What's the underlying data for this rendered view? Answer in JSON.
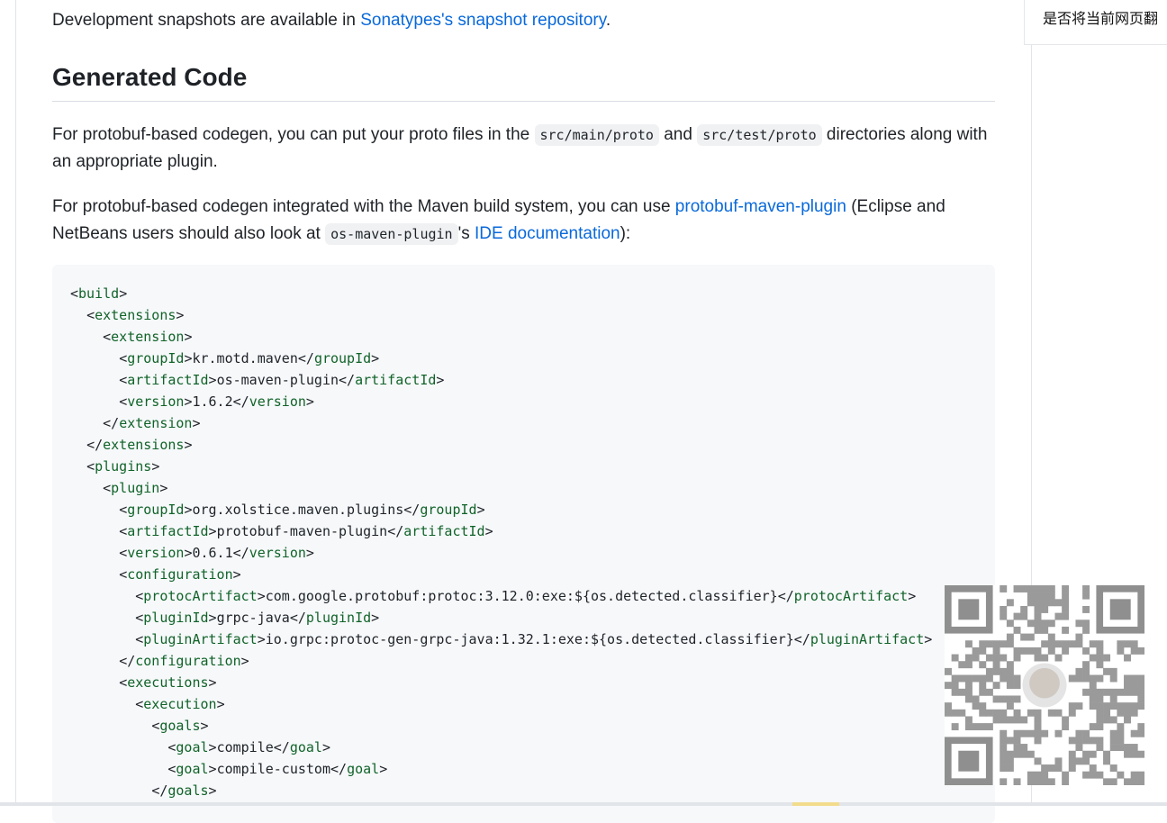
{
  "intro": {
    "before": "Development snapshots are available in ",
    "link": "Sonatypes's snapshot repository",
    "after": "."
  },
  "heading": "Generated Code",
  "para1": {
    "t1": "For protobuf-based codegen, you can put your proto files in the ",
    "code1": "src/main/proto",
    "t2": " and ",
    "code2": "src/test/proto",
    "t3": " directories along with an appropriate plugin."
  },
  "para2": {
    "t1": "For protobuf-based codegen integrated with the Maven build system, you can use ",
    "link1": "protobuf-maven-plugin",
    "t2": " (Eclipse and NetBeans users should also look at ",
    "code1": "os-maven-plugin",
    "t3": "'s ",
    "link2": "IDE documentation",
    "t4": "):"
  },
  "code_lines": [
    {
      "indent": "",
      "tag": "build"
    },
    {
      "indent": "  ",
      "tag": "extensions"
    },
    {
      "indent": "    ",
      "tag": "extension"
    },
    {
      "indent": "      ",
      "tag": "groupId",
      "text": "kr.motd.maven",
      "close": "groupId"
    },
    {
      "indent": "      ",
      "tag": "artifactId",
      "text": "os-maven-plugin",
      "close": "artifactId"
    },
    {
      "indent": "      ",
      "tag": "version",
      "text": "1.6.2",
      "close": "version"
    },
    {
      "indent": "    ",
      "close": "extension"
    },
    {
      "indent": "  ",
      "close": "extensions"
    },
    {
      "indent": "  ",
      "tag": "plugins"
    },
    {
      "indent": "    ",
      "tag": "plugin"
    },
    {
      "indent": "      ",
      "tag": "groupId",
      "text": "org.xolstice.maven.plugins",
      "close": "groupId"
    },
    {
      "indent": "      ",
      "tag": "artifactId",
      "text": "protobuf-maven-plugin",
      "close": "artifactId"
    },
    {
      "indent": "      ",
      "tag": "version",
      "text": "0.6.1",
      "close": "version"
    },
    {
      "indent": "      ",
      "tag": "configuration"
    },
    {
      "indent": "        ",
      "tag": "protocArtifact",
      "text": "com.google.protobuf:protoc:3.12.0:exe:${os.detected.classifier}",
      "close": "protocArtifact"
    },
    {
      "indent": "        ",
      "tag": "pluginId",
      "text": "grpc-java",
      "close": "pluginId"
    },
    {
      "indent": "        ",
      "tag": "pluginArtifact",
      "text": "io.grpc:protoc-gen-grpc-java:1.32.1:exe:${os.detected.classifier}",
      "close": "pluginArtifact"
    },
    {
      "indent": "      ",
      "close": "configuration"
    },
    {
      "indent": "      ",
      "tag": "executions"
    },
    {
      "indent": "        ",
      "tag": "execution"
    },
    {
      "indent": "          ",
      "tag": "goals"
    },
    {
      "indent": "            ",
      "tag": "goal",
      "text": "compile",
      "close": "goal"
    },
    {
      "indent": "            ",
      "tag": "goal",
      "text": "compile-custom",
      "close": "goal"
    },
    {
      "indent": "          ",
      "close": "goals"
    }
  ],
  "translate_prompt": "是否将当前网页翻"
}
